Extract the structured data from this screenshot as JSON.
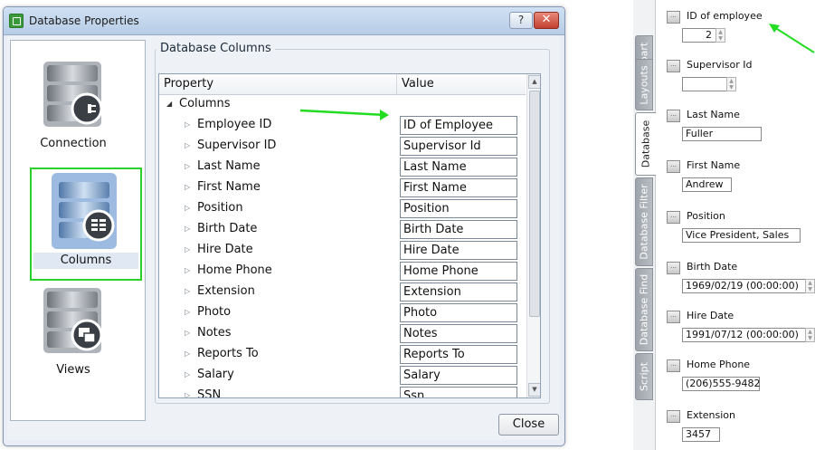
{
  "dialog": {
    "title": "Database Properties",
    "help_label": "?",
    "close_x_label": "✕",
    "nav": [
      {
        "label": "Connection"
      },
      {
        "label": "Columns"
      },
      {
        "label": "Views"
      }
    ],
    "group_title": "Database Columns",
    "grid": {
      "headers": {
        "property": "Property",
        "value": "Value"
      },
      "root": "Columns",
      "rows": [
        {
          "name": "Employee ID",
          "value": "ID of Employee"
        },
        {
          "name": "Supervisor ID",
          "value": "Supervisor Id"
        },
        {
          "name": "Last Name",
          "value": "Last Name"
        },
        {
          "name": "First Name",
          "value": "First Name"
        },
        {
          "name": "Position",
          "value": "Position"
        },
        {
          "name": "Birth Date",
          "value": "Birth Date"
        },
        {
          "name": "Hire Date",
          "value": "Hire Date"
        },
        {
          "name": "Home Phone",
          "value": "Home Phone"
        },
        {
          "name": "Extension",
          "value": "Extension"
        },
        {
          "name": "Photo",
          "value": "Photo"
        },
        {
          "name": "Notes",
          "value": "Notes"
        },
        {
          "name": "Reports To",
          "value": "Reports To"
        },
        {
          "name": "Salary",
          "value": "Salary"
        },
        {
          "name": "SSN",
          "value": "Ssn"
        }
      ]
    },
    "close_button": "Close"
  },
  "side_panel": {
    "tabs": [
      "Clipart",
      "Layouts",
      "Database",
      "Database Filter",
      "Database Find",
      "Script"
    ],
    "active_tab": "Database",
    "fields": [
      {
        "label": "ID of employee",
        "value": "2"
      },
      {
        "label": "Supervisor Id",
        "value": ""
      },
      {
        "label": "Last Name",
        "value": "Fuller"
      },
      {
        "label": "First Name",
        "value": "Andrew"
      },
      {
        "label": "Position",
        "value": "Vice President, Sales"
      },
      {
        "label": "Birth Date",
        "value": "1969/02/19 (00:00:00)"
      },
      {
        "label": "Hire Date",
        "value": "1991/07/12 (00:00:00)"
      },
      {
        "label": "Home Phone",
        "value": "(206)555-9482"
      },
      {
        "label": "Extension",
        "value": "3457"
      }
    ]
  },
  "colors": {
    "highlight": "#2bd22b",
    "title_bar": "#b7cde6"
  }
}
